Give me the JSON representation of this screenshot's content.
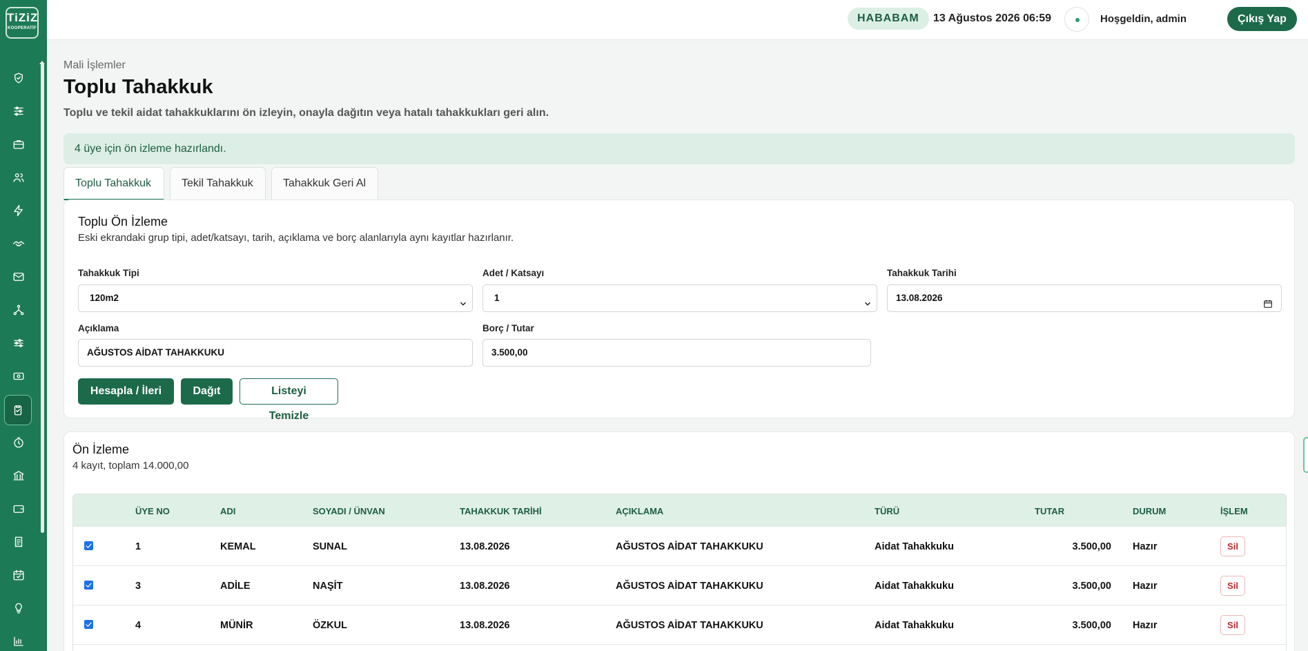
{
  "sidebar": {
    "logo_text": "TiZiZ",
    "logo_sub": "KOOPERATİF",
    "icons": [
      "shield-check-icon",
      "sliders-icon",
      "briefcase-icon",
      "users-icon",
      "bolt-icon",
      "handshake-icon",
      "mail-icon",
      "network-icon",
      "settings-sliders-icon",
      "banknote-icon",
      "clipboard-check-icon",
      "timer-icon",
      "bank-icon",
      "wallet-icon",
      "receipt-icon",
      "calendar-check-icon",
      "lightbulb-icon",
      "bar-chart-icon"
    ],
    "active_index": 10
  },
  "topbar": {
    "org": "HABABAM",
    "datetime": "13 Ağustos 2026 06:59",
    "welcome": "Hoşgeldin, admin",
    "logout": "Çıkış Yap"
  },
  "page": {
    "breadcrumb": "Mali İşlemler",
    "title": "Toplu Tahakkuk",
    "description": "Toplu ve tekil aidat tahakkuklarını ön izleyin, onayla dağıtın veya hatalı tahakkukları geri alın."
  },
  "alert": "4 üye için ön izleme hazırlandı.",
  "tabs": [
    {
      "label": "Toplu Tahakkuk",
      "active": true
    },
    {
      "label": "Tekil Tahakkuk",
      "active": false
    },
    {
      "label": "Tahakkuk Geri Al",
      "active": false
    }
  ],
  "form": {
    "title": "Toplu Ön İzleme",
    "subtitle": "Eski ekrandaki grup tipi, adet/katsayı, tarih, açıklama ve borç alanlarıyla aynı kayıtlar hazırlanır.",
    "type_label": "Tahakkuk Tipi",
    "type_value": "120m2",
    "qty_label": "Adet / Katsayı",
    "qty_value": "1",
    "date_label": "Tahakkuk Tarihi",
    "date_value": "13.08.2026",
    "desc_label": "Açıklama",
    "desc_value": "AĞUSTOS AİDAT TAHAKKUKU",
    "amount_label": "Borç / Tutar",
    "amount_value": "3.500,00",
    "btn_calc": "Hesapla / İleri",
    "btn_distribute": "Dağıt",
    "btn_clear": "Listeyi Temizle"
  },
  "preview": {
    "title": "Ön İzleme",
    "summary": "4 kayıt, toplam 14.000,00",
    "columns": [
      "ÜYE NO",
      "ADI",
      "SOYADI / ÜNVAN",
      "TAHAKKUK TARİHİ",
      "AÇIKLAMA",
      "TÜRÜ",
      "TUTAR",
      "DURUM",
      "İŞLEM"
    ],
    "rows": [
      {
        "checked": true,
        "no": "1",
        "name": "KEMAL",
        "surname": "SUNAL",
        "date": "13.08.2026",
        "desc": "AĞUSTOS AİDAT TAHAKKUKU",
        "type": "Aidat Tahakkuku",
        "amount": "3.500,00",
        "status": "Hazır",
        "action": "Sil"
      },
      {
        "checked": true,
        "no": "3",
        "name": "ADİLE",
        "surname": "NAŞİT",
        "date": "13.08.2026",
        "desc": "AĞUSTOS AİDAT TAHAKKUKU",
        "type": "Aidat Tahakkuku",
        "amount": "3.500,00",
        "status": "Hazır",
        "action": "Sil"
      },
      {
        "checked": true,
        "no": "4",
        "name": "MÜNİR",
        "surname": "ÖZKUL",
        "date": "13.08.2026",
        "desc": "AĞUSTOS AİDAT TAHAKKUKU",
        "type": "Aidat Tahakkuku",
        "amount": "3.500,00",
        "status": "Hazır",
        "action": "Sil"
      }
    ]
  },
  "colors": {
    "sidebar": "#1d7a57",
    "primary": "#1c6a4a",
    "accent_light": "#dceee5",
    "danger": "#c0272d"
  }
}
